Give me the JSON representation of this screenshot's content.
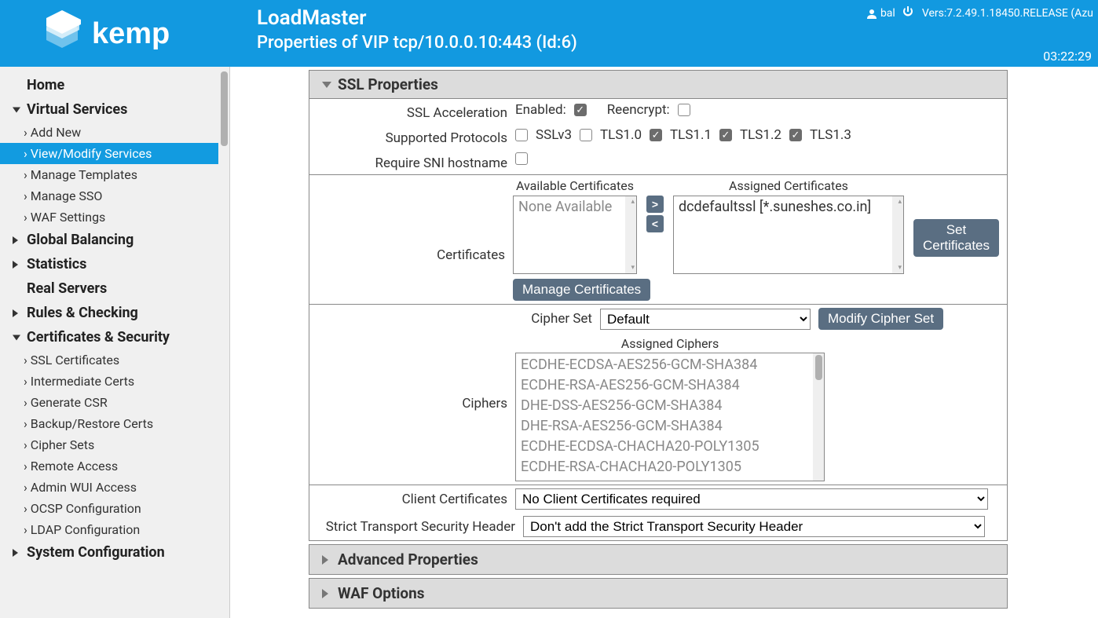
{
  "header": {
    "app_title": "LoadMaster",
    "subtitle": "Properties of VIP tcp/10.0.0.10:443 (Id:6)",
    "user": "bal",
    "version": "Vers:7.2.49.1.18450.RELEASE (Azu",
    "clock": "03:22:29"
  },
  "sidebar": {
    "home": "Home",
    "virtual_services": "Virtual Services",
    "vs_items": [
      "Add New",
      "View/Modify Services",
      "Manage Templates",
      "Manage SSO",
      "WAF Settings"
    ],
    "global_balancing": "Global Balancing",
    "statistics": "Statistics",
    "real_servers": "Real Servers",
    "rules_checking": "Rules & Checking",
    "certs_security": "Certificates & Security",
    "cs_items": [
      "SSL Certificates",
      "Intermediate Certs",
      "Generate CSR",
      "Backup/Restore Certs",
      "Cipher Sets",
      "Remote Access",
      "Admin WUI Access",
      "OCSP Configuration",
      "LDAP Configuration"
    ],
    "system_config": "System Configuration"
  },
  "ssl": {
    "section_title": "SSL Properties",
    "accel_label": "SSL Acceleration",
    "enabled_label": "Enabled:",
    "reencrypt_label": "Reencrypt:",
    "protocols_label": "Supported Protocols",
    "protocols": [
      "SSLv3",
      "TLS1.0",
      "TLS1.1",
      "TLS1.2",
      "TLS1.3"
    ],
    "sni_label": "Require SNI hostname",
    "certs_label": "Certificates",
    "avail_title": "Available Certificates",
    "assigned_title": "Assigned Certificates",
    "none_available": "None Available",
    "assigned_cert": "dcdefaultssl [*.suneshes.co.in]",
    "set_certs_btn": "Set Certificates",
    "manage_certs_btn": "Manage Certificates",
    "cipherset_label": "Cipher Set",
    "cipherset_value": "Default",
    "modify_cipher_btn": "Modify Cipher Set",
    "ciphers_label": "Ciphers",
    "assigned_ciphers_title": "Assigned Ciphers",
    "ciphers": [
      "ECDHE-ECDSA-AES256-GCM-SHA384",
      "ECDHE-RSA-AES256-GCM-SHA384",
      "DHE-DSS-AES256-GCM-SHA384",
      "DHE-RSA-AES256-GCM-SHA384",
      "ECDHE-ECDSA-CHACHA20-POLY1305",
      "ECDHE-RSA-CHACHA20-POLY1305"
    ],
    "client_certs_label": "Client Certificates",
    "client_certs_value": "No Client Certificates required",
    "hsts_label": "Strict Transport Security Header",
    "hsts_value": "Don't add the Strict Transport Security Header"
  },
  "panels": {
    "advanced": "Advanced Properties",
    "waf": "WAF Options"
  }
}
